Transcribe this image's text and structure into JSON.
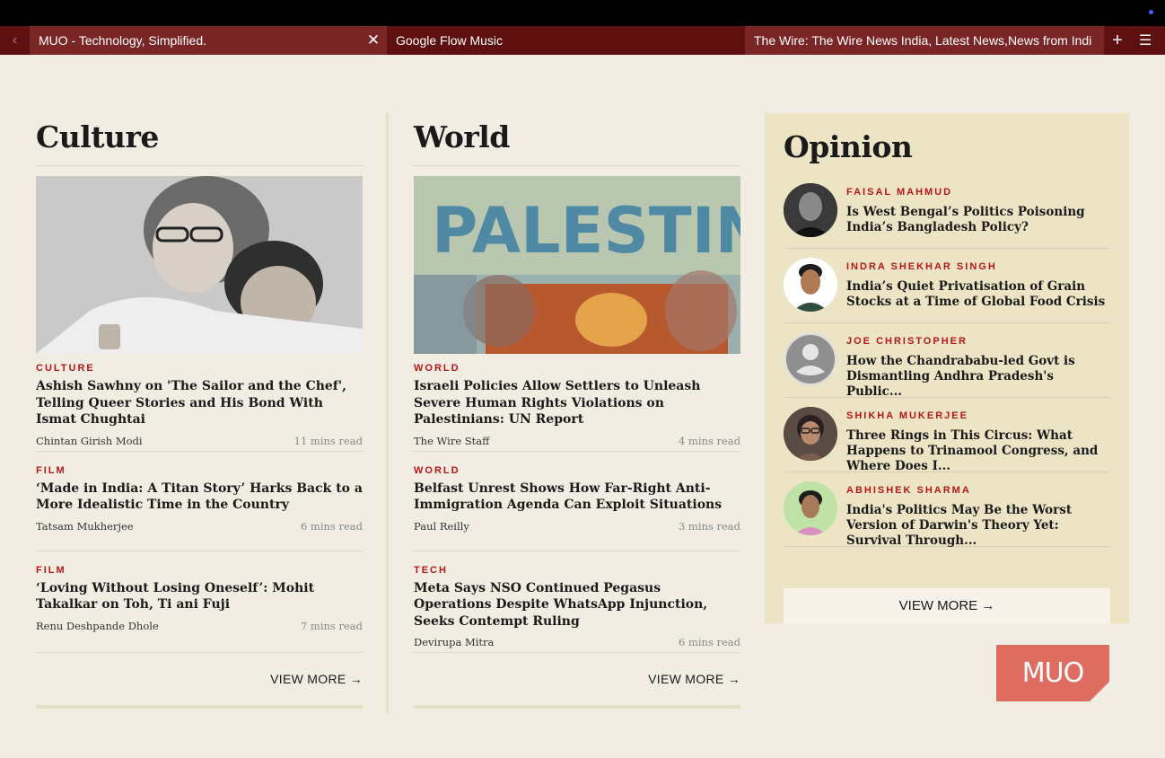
{
  "tabs": [
    {
      "title": "MUO - Technology, Simplified.",
      "active": true
    },
    {
      "title": "Google Flow Music"
    },
    {
      "title": "The Wire: The Wire News India, Latest News,News from Indi"
    }
  ],
  "tab_controls": {
    "close_glyph": "✕",
    "plus_glyph": "+",
    "menu_glyph": "☰",
    "back_glyph": "‹"
  },
  "culture": {
    "title": "Culture",
    "articles": [
      {
        "tag": "CULTURE",
        "headline": "Ashish Sawhny on 'The Sailor and the Chef', Telling Queer Stories and His Bond With Ismat Chughtai",
        "author": "Chintan Girish Modi",
        "read": "11 mins read"
      },
      {
        "tag": "FILM",
        "headline": "‘Made in India: A Titan Story’ Harks Back to a More Idealistic Time in the Country",
        "author": "Tatsam Mukherjee",
        "read": "6 mins read"
      },
      {
        "tag": "FILM",
        "headline": "‘Loving Without Losing Oneself’: Mohit Takalkar on Toh, Ti ani Fuji",
        "author": "Renu Deshpande Dhole",
        "read": "7 mins read"
      }
    ],
    "view_more": "VIEW MORE →"
  },
  "world": {
    "title": "World",
    "articles": [
      {
        "tag": "WORLD",
        "headline": "Israeli Policies Allow Settlers to Unleash Severe Human Rights Violations on Palestinians: UN Report",
        "author": "The Wire Staff",
        "read": "4 mins read"
      },
      {
        "tag": "WORLD",
        "headline": "Belfast Unrest Shows How Far-Right Anti-Immigration Agenda Can Exploit Situations",
        "author": "Paul Reilly",
        "read": "3 mins read"
      },
      {
        "tag": "TECH",
        "headline": "Meta Says NSO Continued Pegasus Operations Despite WhatsApp Injunction, Seeks Contempt Ruling",
        "author": "Devirupa Mitra",
        "read": "6 mins read"
      }
    ],
    "view_more": "VIEW MORE →",
    "hero_sign_text": "PALESTINE"
  },
  "opinion": {
    "title": "Opinion",
    "items": [
      {
        "name": "FAISAL MAHMUD",
        "headline": "Is West Bengal’s Politics Poisoning India’s Bangladesh Policy?"
      },
      {
        "name": "INDRA SHEKHAR SINGH",
        "headline": "India’s Quiet Privatisation of Grain Stocks at a Time of Global Food Crisis"
      },
      {
        "name": "JOE CHRISTOPHER",
        "headline": "How the Chandrababu-led Govt is Dismantling Andhra Pradesh's Public..."
      },
      {
        "name": "SHIKHA MUKERJEE",
        "headline": "Three Rings in This Circus: What Happens to Trinamool Congress, and Where Does I..."
      },
      {
        "name": "ABHISHEK SHARMA",
        "headline": "India's Politics May Be the Worst Version of Darwin's Theory Yet: Survival Through..."
      }
    ],
    "view_more": "VIEW MORE →"
  },
  "watermark": {
    "text": "MUO"
  }
}
